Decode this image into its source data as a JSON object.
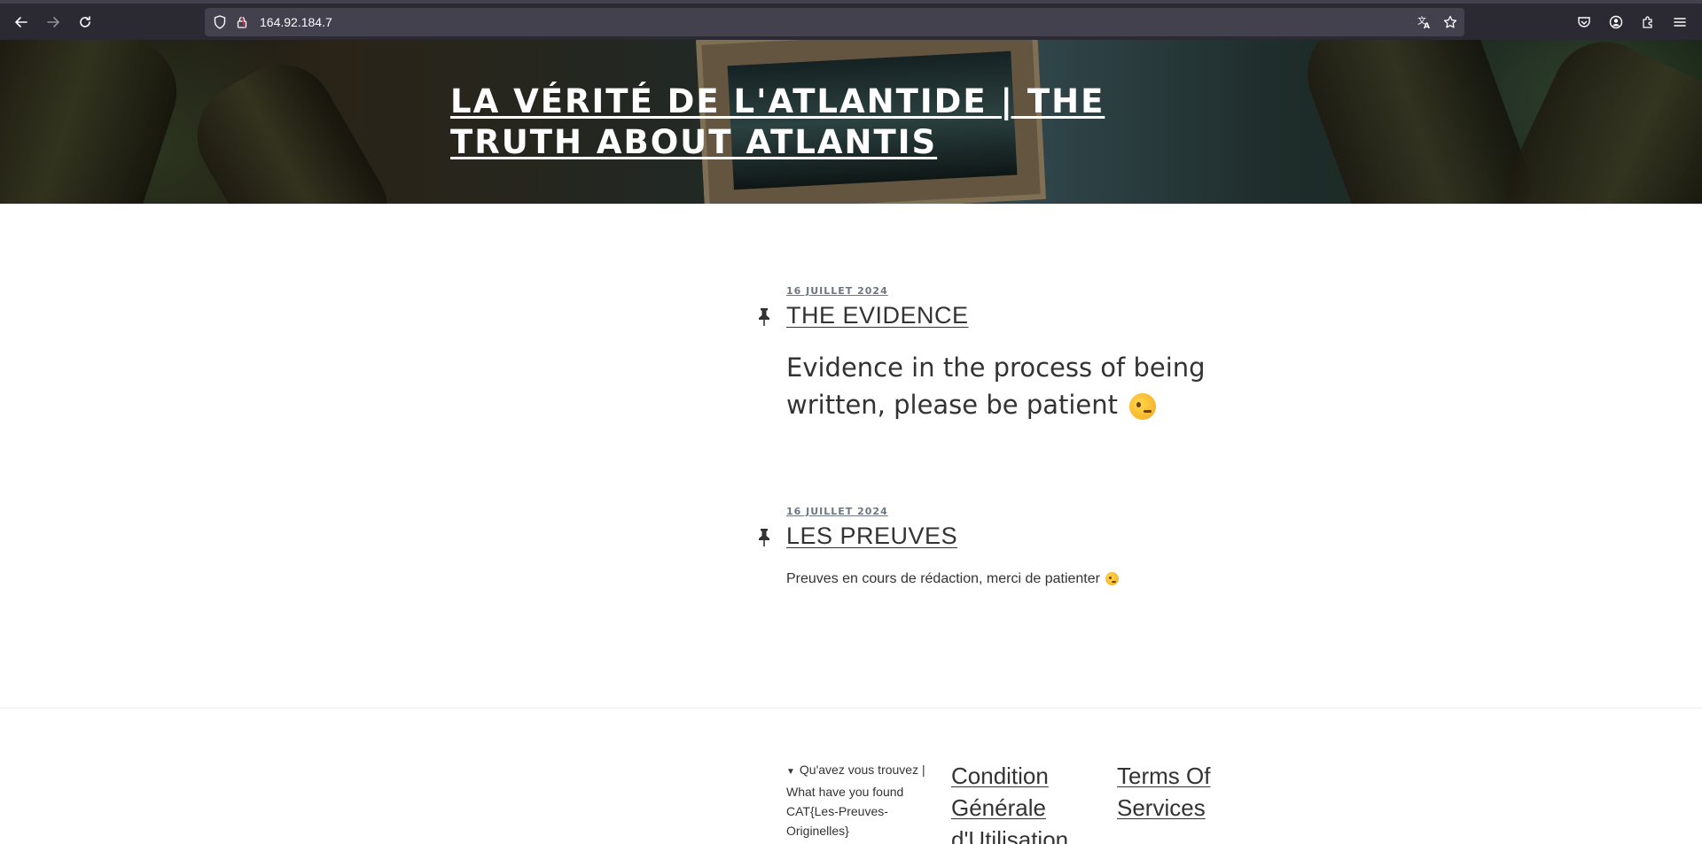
{
  "browser": {
    "url": "164.92.184.7"
  },
  "site": {
    "title": "La Vérité de l'Atlantide | The Truth About Atlantis"
  },
  "posts": [
    {
      "date": "16 juillet 2024",
      "title": "The Evidence",
      "excerpt": "Evidence in the process of being written, please be patient"
    },
    {
      "date": "16 juillet 2024",
      "title": "Les Preuves",
      "excerpt": "Preuves en cours de rédaction, merci de patienter"
    }
  ],
  "footer": {
    "details_summary": "Qu'avez vous trouvez | What have you found",
    "details_content": "CAT{Les-Preuves-Originelles}",
    "links": [
      {
        "label": "Condition Générale d'Utilisation"
      },
      {
        "label": "Terms Of Services"
      }
    ]
  }
}
